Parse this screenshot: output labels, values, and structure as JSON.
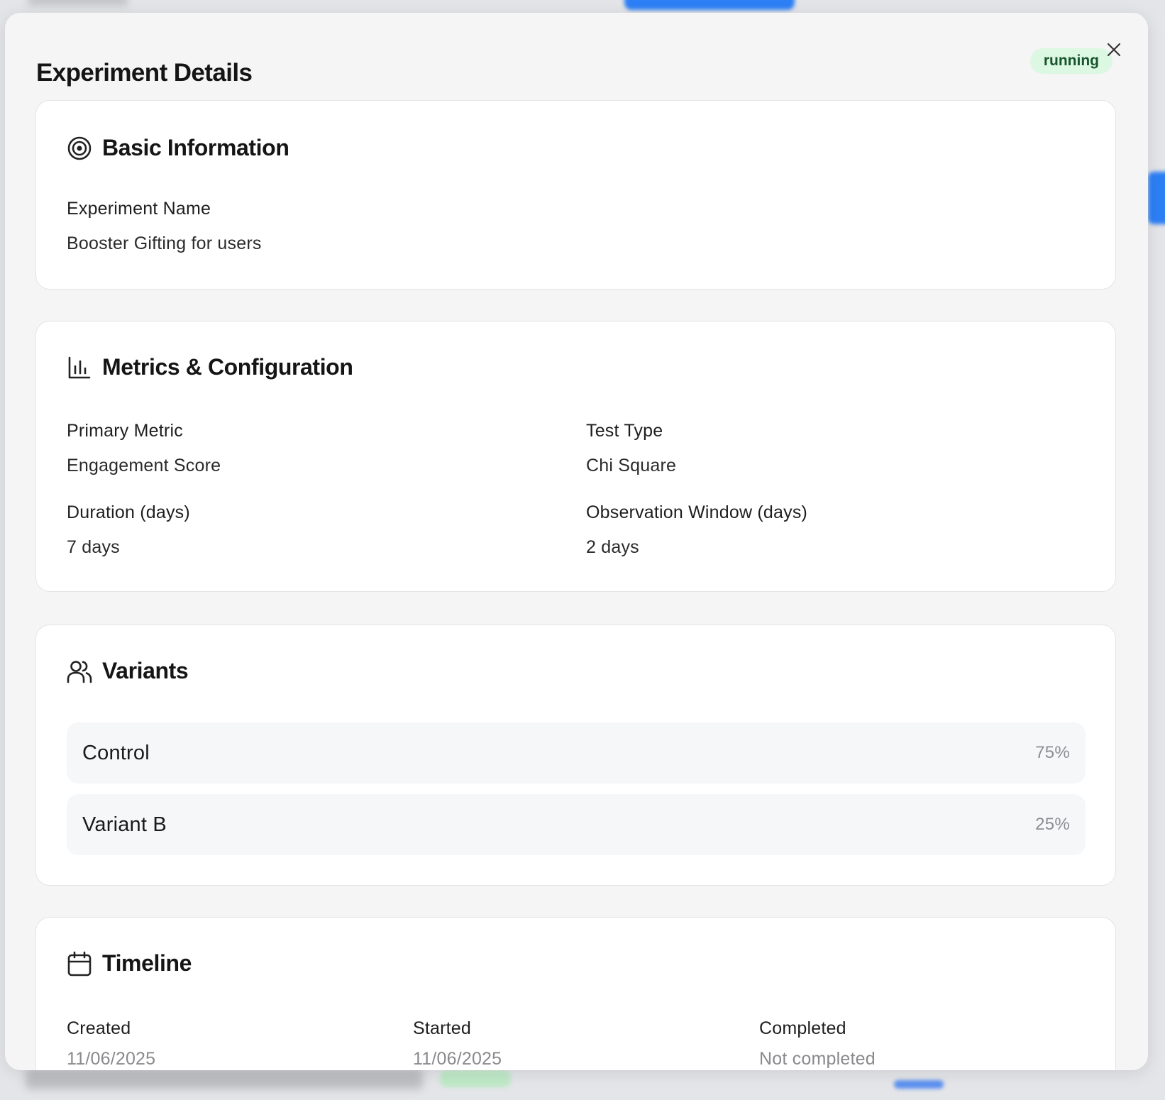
{
  "modal": {
    "title": "Experiment Details",
    "status": "running",
    "colors": {
      "status_bg": "#dcf7e2",
      "status_text": "#17542b"
    }
  },
  "basic_info": {
    "heading": "Basic Information",
    "icon": "target-icon",
    "name_label": "Experiment Name",
    "name_value": "Booster Gifting for users"
  },
  "metrics": {
    "heading": "Metrics & Configuration",
    "icon": "bar-chart-icon",
    "primary_metric_label": "Primary Metric",
    "primary_metric_value": "Engagement Score",
    "test_type_label": "Test Type",
    "test_type_value": "Chi Square",
    "duration_label": "Duration (days)",
    "duration_value": "7 days",
    "observation_label": "Observation Window (days)",
    "observation_value": "2 days"
  },
  "variants": {
    "heading": "Variants",
    "icon": "users-icon",
    "items": [
      {
        "name": "Control",
        "allocation": "75%"
      },
      {
        "name": "Variant B",
        "allocation": "25%"
      }
    ]
  },
  "timeline": {
    "heading": "Timeline",
    "icon": "calendar-icon",
    "created_label": "Created",
    "created_value": "11/06/2025",
    "started_label": "Started",
    "started_value": "11/06/2025",
    "completed_label": "Completed",
    "completed_value": "Not completed"
  }
}
